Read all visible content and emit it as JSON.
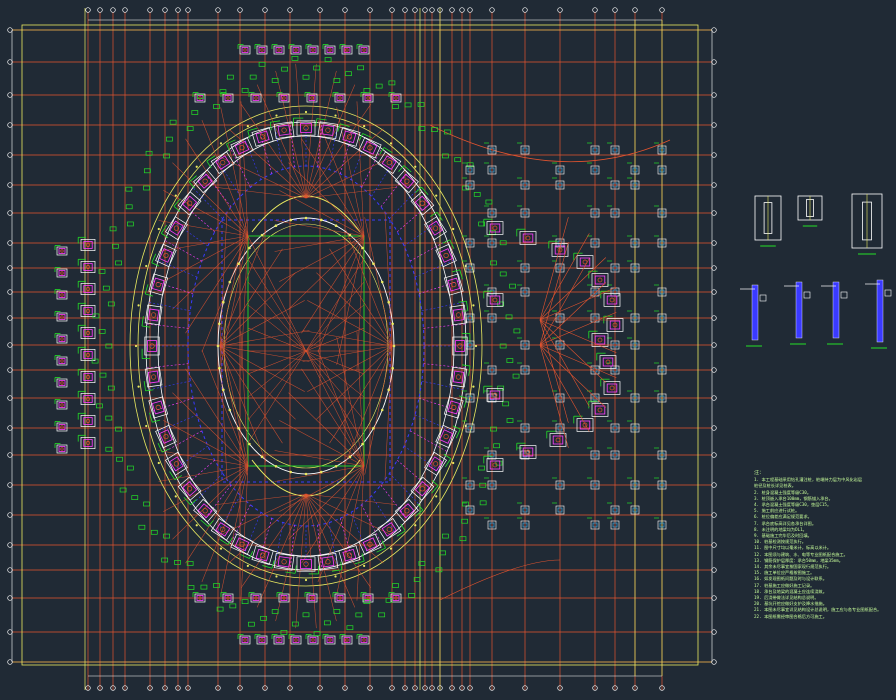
{
  "drawing": {
    "title": "",
    "notes_title": "注：",
    "notes": [
      "1. 本工程基础采用钻孔灌注桩，桩端持力层为中风化岩层",
      "   桩径及桩长详见桩表。",
      "2. 桩身混凝土强度等级C30。",
      "3. 桩顶嵌入承台100mm，钢筋锚入承台。",
      "4. 承台混凝土强度等级C30，垫层C15。",
      "5. 施工前应进行试桩。",
      "6. 桩位偏差应满足规范要求。",
      "7. 承台底标高详见各承台详图。",
      "8. 未注明的地梁均为DL1。",
      "9. 基础施工完毕后及时回填。",
      "10. 桩基检测按规范执行。",
      "11. 图中尺寸均以毫米计，标高以米计。",
      "12. 本图须与建筑、水、电等专业图纸配合施工。",
      "13. 钢筋保护层厚度：承台50mm，地梁35mm。",
      "14. 其余未尽事宜按国家现行规范执行。",
      "15. 施工单位应严格按图施工。",
      "16. 如发现图纸问题及时与设计联系。",
      "17. 桩基施工应做好施工记录。",
      "18. 承台及地梁的混凝土应连续浇筑。",
      "19. 后浇带做法详见结构总说明。",
      "20. 基坑开挖应做好支护及降水措施。",
      "21. 本图未尽事宜详见结构设计总说明，施工应与各专业图纸配合。",
      "22. 本图纸需经审图合格后方可施工。"
    ]
  },
  "colors": {
    "background": "#202a35",
    "grid_red": "#e4542f",
    "grid_yellow": "#eaea60",
    "green": "#23e026",
    "blue": "#3a3aff",
    "magenta": "#ff3cff",
    "white": "#ffffff",
    "cyan": "#40c0ff",
    "note_text": "#c8ff9a"
  },
  "icons": [
    "pile-cap-symbol",
    "column-detail",
    "section-detail"
  ]
}
